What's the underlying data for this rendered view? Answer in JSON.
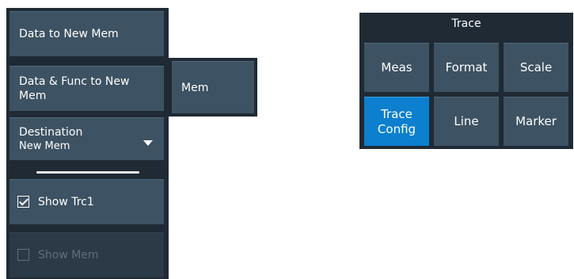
{
  "left_panel": {
    "data_to_new_mem": "Data to New Mem",
    "data_func_line1": "Data & Func to New",
    "data_func_line2": "Mem",
    "destination_label": "Destination",
    "destination_value": "New Mem",
    "show_trc1": "Show Trc1",
    "show_trc1_checked": true,
    "show_mem": "Show Mem",
    "show_mem_enabled": false
  },
  "flyout": {
    "mem_label": "Mem"
  },
  "trace_panel": {
    "title": "Trace",
    "buttons": [
      {
        "label": "Meas"
      },
      {
        "label": "Format"
      },
      {
        "label": "Scale"
      },
      {
        "label_line1": "Trace",
        "label_line2": "Config",
        "active": true
      },
      {
        "label": "Line"
      },
      {
        "label": "Marker"
      }
    ]
  },
  "colors": {
    "panel_bg": "#1f2a35",
    "button_bg": "#3d5262",
    "active_button_bg": "#0c7fce",
    "disabled_text": "#5f6f7c"
  }
}
